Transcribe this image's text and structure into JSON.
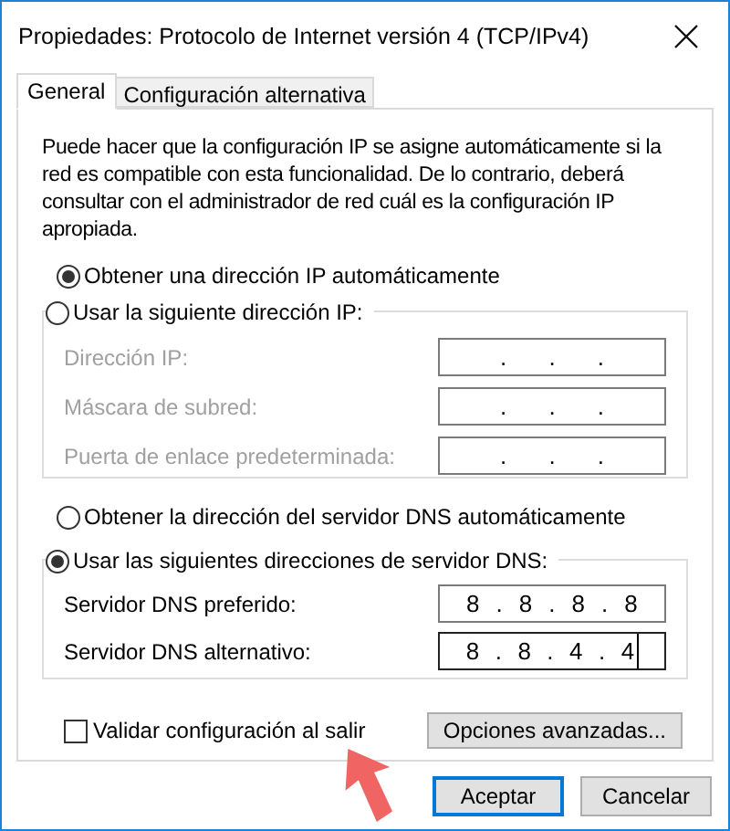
{
  "window": {
    "title": "Propiedades: Protocolo de Internet versión 4 (TCP/IPv4)"
  },
  "tabs": [
    {
      "label": "General",
      "selected": true
    },
    {
      "label": "Configuración alternativa",
      "selected": false
    }
  ],
  "description": "Puede hacer que la configuración IP se asigne automáticamente si la red es compatible con esta funcionalidad. De lo contrario, deberá consultar con el administrador de red cuál es la configuración IP apropiada.",
  "ip_mode": [
    {
      "label": "Obtener una dirección IP automáticamente",
      "selected": true
    },
    {
      "label": "Usar la siguiente dirección IP:",
      "selected": false
    }
  ],
  "ip_fields": [
    {
      "label": "Dirección IP:",
      "value": ". . .",
      "disabled": true,
      "focused": false
    },
    {
      "label": "Máscara de subred:",
      "value": ". . .",
      "disabled": true,
      "focused": false
    },
    {
      "label": "Puerta de enlace predeterminada:",
      "value": ". . .",
      "disabled": true,
      "focused": false
    }
  ],
  "dns_mode": [
    {
      "label": "Obtener la dirección del servidor DNS automáticamente",
      "selected": false
    },
    {
      "label": "Usar las siguientes direcciones de servidor DNS:",
      "selected": true
    }
  ],
  "dns_fields": [
    {
      "label": "Servidor DNS preferido:",
      "value": "8 . 8 . 8 . 8",
      "disabled": false,
      "focused": false
    },
    {
      "label": "Servidor DNS alternativo:",
      "value": "8 . 8 . 4 . 4",
      "disabled": false,
      "focused": true
    }
  ],
  "validate": {
    "label": "Validar configuración al salir",
    "checked": false
  },
  "advanced_button": {
    "label": "Opciones avanzadas..."
  },
  "buttons": [
    {
      "label": "Aceptar",
      "default": true
    },
    {
      "label": "Cancelar",
      "default": false
    }
  ]
}
